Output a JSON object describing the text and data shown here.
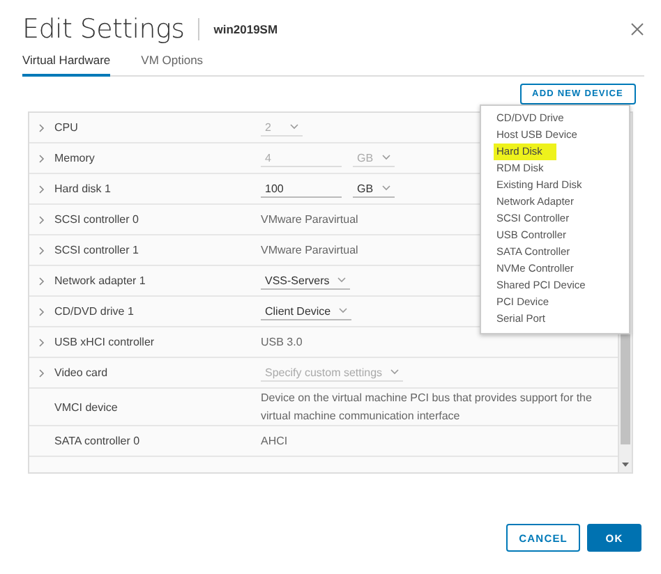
{
  "dialog": {
    "title": "Edit Settings",
    "vm_name": "win2019SM"
  },
  "tabs": [
    {
      "label": "Virtual Hardware",
      "selected": true
    },
    {
      "label": "VM Options",
      "selected": false
    }
  ],
  "add_button": "ADD NEW DEVICE",
  "rows": [
    {
      "label": "CPU",
      "expandable": true,
      "kind": "select",
      "value": "2",
      "disabled": true
    },
    {
      "label": "Memory",
      "expandable": true,
      "kind": "size",
      "amount": "4",
      "unit": "GB",
      "disabled": true
    },
    {
      "label": "Hard disk 1",
      "expandable": true,
      "kind": "size",
      "amount": "100",
      "unit": "GB",
      "disabled": false
    },
    {
      "label": "SCSI controller 0",
      "expandable": true,
      "kind": "text",
      "value": "VMware Paravirtual"
    },
    {
      "label": "SCSI controller 1",
      "expandable": true,
      "kind": "text",
      "value": "VMware Paravirtual"
    },
    {
      "label": "Network adapter 1",
      "expandable": true,
      "kind": "select",
      "value": "VSS-Servers",
      "disabled": false
    },
    {
      "label": "CD/DVD drive 1",
      "expandable": true,
      "kind": "select",
      "value": "Client Device",
      "disabled": false
    },
    {
      "label": "USB xHCI controller",
      "expandable": true,
      "kind": "text",
      "value": "USB 3.0"
    },
    {
      "label": "Video card",
      "expandable": true,
      "kind": "select",
      "value": "Specify custom settings",
      "disabled": true
    },
    {
      "label": "VMCI device",
      "expandable": false,
      "kind": "text",
      "value": "Device on the virtual machine PCI bus that provides support for the virtual machine communication interface"
    },
    {
      "label": "SATA controller 0",
      "expandable": false,
      "kind": "text",
      "value": "AHCI"
    }
  ],
  "device_menu": [
    {
      "label": "CD/DVD Drive",
      "selected": false
    },
    {
      "label": "Host USB Device",
      "selected": false
    },
    {
      "label": "Hard Disk",
      "selected": true
    },
    {
      "label": "RDM Disk",
      "selected": false
    },
    {
      "label": "Existing Hard Disk",
      "selected": false
    },
    {
      "label": "Network Adapter",
      "selected": false
    },
    {
      "label": "SCSI Controller",
      "selected": false
    },
    {
      "label": "USB Controller",
      "selected": false
    },
    {
      "label": "SATA Controller",
      "selected": false
    },
    {
      "label": "NVMe Controller",
      "selected": false
    },
    {
      "label": "Shared PCI Device",
      "selected": false
    },
    {
      "label": "PCI Device",
      "selected": false
    },
    {
      "label": "Serial Port",
      "selected": false
    }
  ],
  "buttons": [
    {
      "label": "CANCEL",
      "kind": "secondary"
    },
    {
      "label": "OK",
      "kind": "primary"
    }
  ]
}
